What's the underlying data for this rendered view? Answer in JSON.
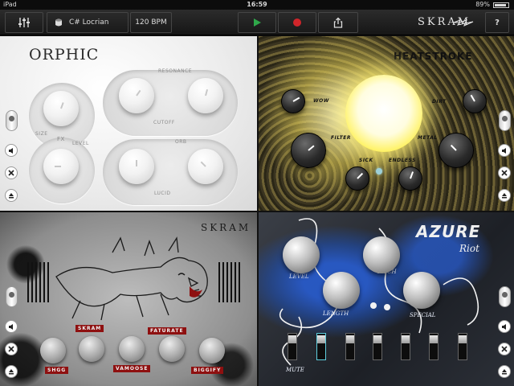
{
  "status_bar": {
    "device": "iPad",
    "time": "16:59",
    "battery": "89%",
    "battery_level": 0.89
  },
  "toolbar": {
    "scale": "C# Locrian",
    "tempo": "120 BPM",
    "brand": "SKRAM",
    "help": "?"
  },
  "orphic": {
    "title": "ORPHIC",
    "labels": {
      "resonance": "RESONANCE",
      "cutoff": "CUTOFF",
      "size": "SIZE",
      "fx": "FX",
      "level": "LEVEL",
      "orb": "ORB",
      "lucid": "LUCID"
    }
  },
  "heatstroke": {
    "title": "HEATSTROKE",
    "labels": {
      "wow": "WOW",
      "dirt": "DIRT",
      "filter": "FILTER",
      "metal": "METAL",
      "sick": "SICK",
      "endless": "ENDLESS"
    }
  },
  "skram": {
    "title": "SKRAM",
    "tags": {
      "skram": "SKRAM",
      "faturate": "FATURATE",
      "shgg": "SHGG",
      "vamoose": "VAMOOSE",
      "biggify": "BIGGIFY"
    }
  },
  "azure": {
    "title": "AZURE",
    "subtitle": "Riot",
    "labels": {
      "level": "LEVEL",
      "pitch": "PITCH",
      "length": "LENGTH",
      "special": "SPECIAL",
      "mute": "MUTE"
    }
  },
  "colors": {
    "accent_green": "#2fa84a",
    "record_red": "#d0252a",
    "skram_red": "#8e1010",
    "azure_blue": "#1e4fb3",
    "heat_glow": "#fff36a"
  },
  "icons": [
    "mixer-sliders-icon",
    "drum-icon",
    "play-icon",
    "record-icon",
    "share-icon",
    "lightning-icon",
    "slider-icon",
    "volume-icon",
    "close-icon",
    "eject-icon"
  ]
}
